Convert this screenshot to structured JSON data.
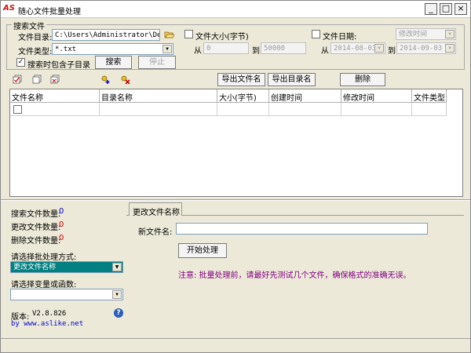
{
  "window": {
    "logo": "AS",
    "title": "随心文件批量处理",
    "minimize": "_",
    "maximize": "□",
    "close": "×"
  },
  "search": {
    "group_title": "搜索文件",
    "dir_label": "文件目录:",
    "dir_value": "C:\\Users\\Administrator\\Desktop",
    "type_label": "文件类型:",
    "type_value": "*.txt",
    "subdir_label": "搜索时包含子目录",
    "subdir_checked": "✓",
    "search_button": "搜索",
    "stop_button": "停止",
    "size_label": "文件大小(字节)",
    "size_from_label": "从",
    "size_from": "0",
    "size_to_label": "到",
    "size_to": "50000",
    "date_label": "文件日期:",
    "date_type": "修改时间",
    "date_from_label": "从",
    "date_from": "2014-08-03",
    "date_to_label": "到",
    "date_to": "2014-09-03"
  },
  "toolbar": {
    "export_filename": "导出文件名",
    "export_dirname": "导出目录名",
    "delete": "删除"
  },
  "table": {
    "columns": [
      "文件名称",
      "目录名称",
      "大小(字节)",
      "创建时间",
      "修改时间",
      "文件类型"
    ]
  },
  "stats": {
    "searched_label": "搜索文件数量:",
    "searched_count": "0",
    "changed_label": "更改文件数量:",
    "changed_count": "0",
    "deleted_label": "删除文件数量:",
    "deleted_count": "0",
    "mode_label": "请选择批处理方式:",
    "mode_value": "更改文件名称",
    "var_label": "请选择变量或函数:",
    "var_value": "",
    "version_label": "版本:",
    "version": "V2.8.826",
    "byline": "by www.aslike.net",
    "help": "?"
  },
  "panel": {
    "tab_label": "更改文件名称",
    "new_name_label": "新文件名:",
    "new_name_value": "",
    "start_button": "开始处理",
    "note": "注意: 批量处理前，请最好先测试几个文件，确保格式的准确无误。"
  },
  "colors": {
    "count_blue": "#0000cc",
    "count_red": "#cc0000",
    "note_purple": "#800080",
    "selected_teal": "#008080",
    "logo_red": "#cc1111"
  }
}
